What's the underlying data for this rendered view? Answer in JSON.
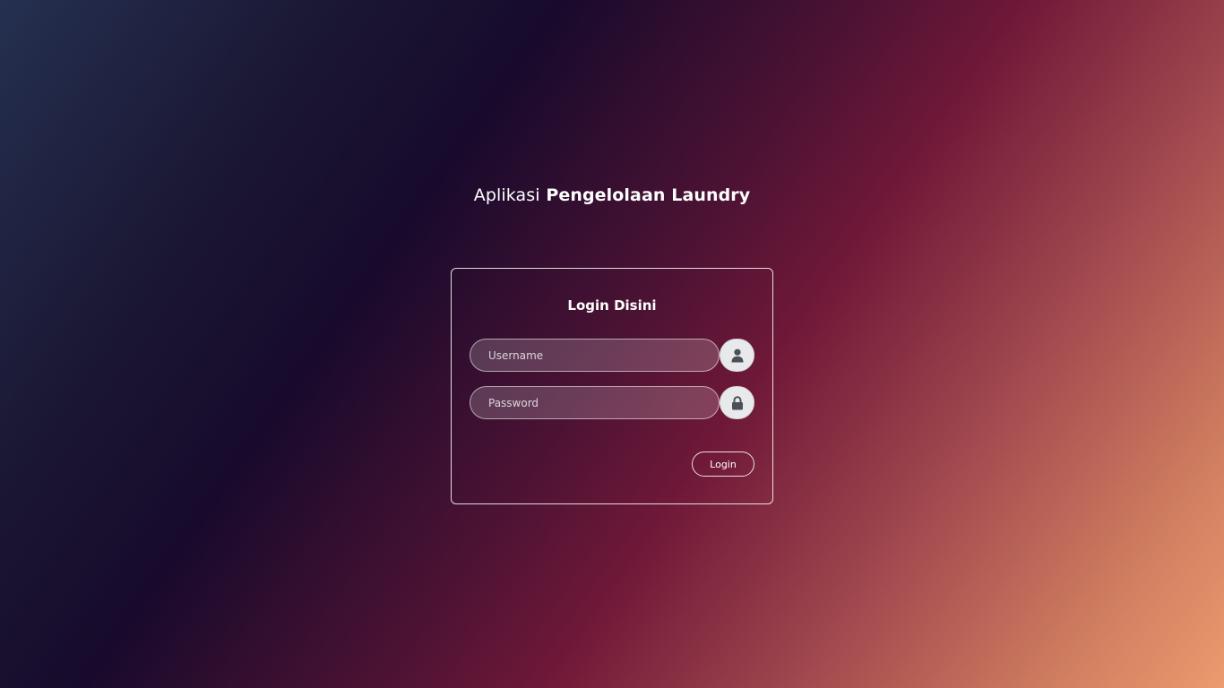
{
  "header": {
    "title_light": "Aplikasi",
    "title_bold": "Pengelolaan Laundry"
  },
  "login_card": {
    "title_light": "Login",
    "title_bold": "Disini",
    "username": {
      "placeholder": "Username",
      "value": "",
      "icon": "user-icon"
    },
    "password": {
      "placeholder": "Password",
      "value": "",
      "icon": "lock-icon"
    },
    "submit_label": "Login"
  },
  "colors": {
    "gradient_start": "#253050",
    "gradient_dark": "#180a2c",
    "gradient_mid": "#6f1838",
    "gradient_end": "#ec9a6e",
    "addon_bg": "#e8e9eb",
    "icon_color": "#4b4f57"
  }
}
